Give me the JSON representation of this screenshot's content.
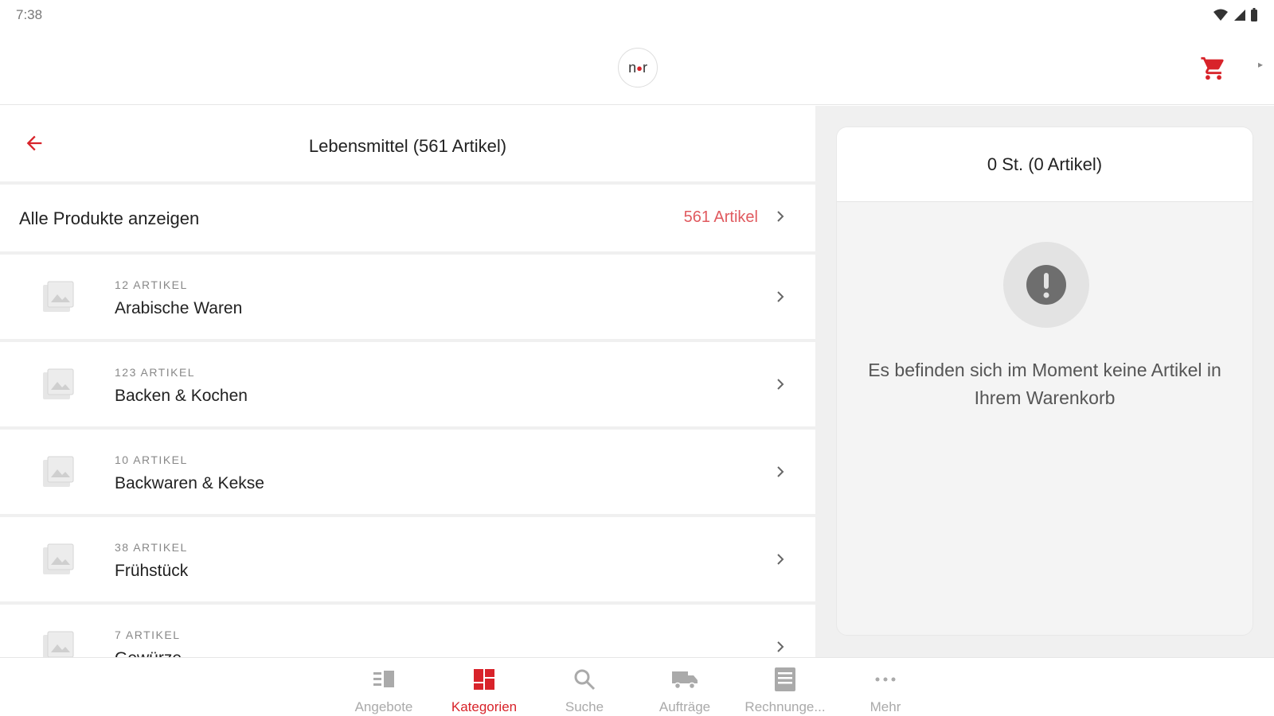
{
  "status": {
    "time": "7:38"
  },
  "appbar": {
    "logo_text_a": "n",
    "logo_text_b": "r",
    "logo_dot": "●"
  },
  "left": {
    "title": "Lebensmittel (561 Artikel)",
    "all_products": {
      "label": "Alle Produkte anzeigen",
      "count": "561 Artikel"
    },
    "categories": [
      {
        "count": "12 ARTIKEL",
        "name": "Arabische Waren"
      },
      {
        "count": "123 ARTIKEL",
        "name": "Backen & Kochen"
      },
      {
        "count": "10 ARTIKEL",
        "name": "Backwaren & Kekse"
      },
      {
        "count": "38 ARTIKEL",
        "name": "Frühstück"
      },
      {
        "count": "7 ARTIKEL",
        "name": "Gewürze"
      }
    ]
  },
  "cart": {
    "summary": "0 St. (0 Artikel)",
    "empty_message": "Es befinden sich im Moment keine Artikel in Ihrem Warenkorb"
  },
  "nav": {
    "items": [
      {
        "label": "Angebote",
        "icon": "offers-icon"
      },
      {
        "label": "Kategorien",
        "icon": "categories-icon"
      },
      {
        "label": "Suche",
        "icon": "search-icon"
      },
      {
        "label": "Aufträge",
        "icon": "truck-icon"
      },
      {
        "label": "Rechnunge...",
        "icon": "invoice-icon"
      },
      {
        "label": "Mehr",
        "icon": "more-icon"
      }
    ],
    "active": "Kategorien"
  },
  "colors": {
    "accent": "#d8232a",
    "muted": "#aaaaaa",
    "count_red": "#e05a5f"
  }
}
